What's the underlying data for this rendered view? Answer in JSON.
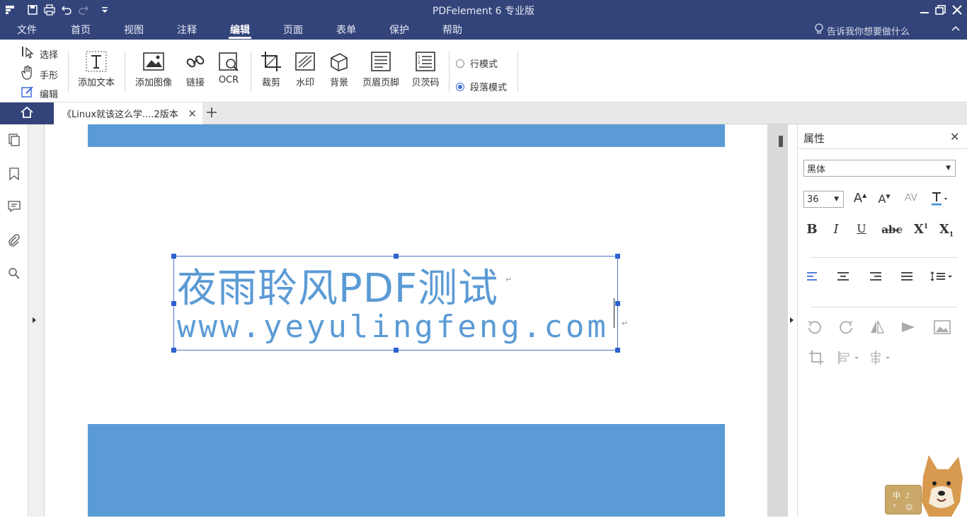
{
  "window": {
    "title": "PDFelement  6 专业版"
  },
  "menu": {
    "items": [
      "文件",
      "首页",
      "视图",
      "注释",
      "编辑",
      "页面",
      "表单",
      "保护",
      "帮助"
    ],
    "active": "编辑",
    "tell_me": "告诉我你想要做什么"
  },
  "ribbon": {
    "select_label": "选择",
    "hand_label": "手形",
    "edit_label": "编辑",
    "add_text": "添加文本",
    "add_image": "添加图像",
    "link": "链接",
    "ocr": "OCR",
    "crop": "裁剪",
    "watermark": "水印",
    "background": "背景",
    "header_footer": "页眉页脚",
    "bates": "贝茨码",
    "line_mode": "行模式",
    "paragraph_mode": "段落模式",
    "selected_mode": "paragraph"
  },
  "tabs": {
    "doc_title": "《Linux就该这么学....2版本"
  },
  "document": {
    "line1": "夜雨聆风PDF测试",
    "line2": "www.yeyulingfeng.com",
    "band_color": "#5b9bd5"
  },
  "properties": {
    "header": "属性",
    "font": "黑体",
    "font_size": "36"
  },
  "colors": {
    "chrome": "#33447a",
    "accent": "#3d6cd9",
    "text_blue": "#5b9bd5"
  }
}
